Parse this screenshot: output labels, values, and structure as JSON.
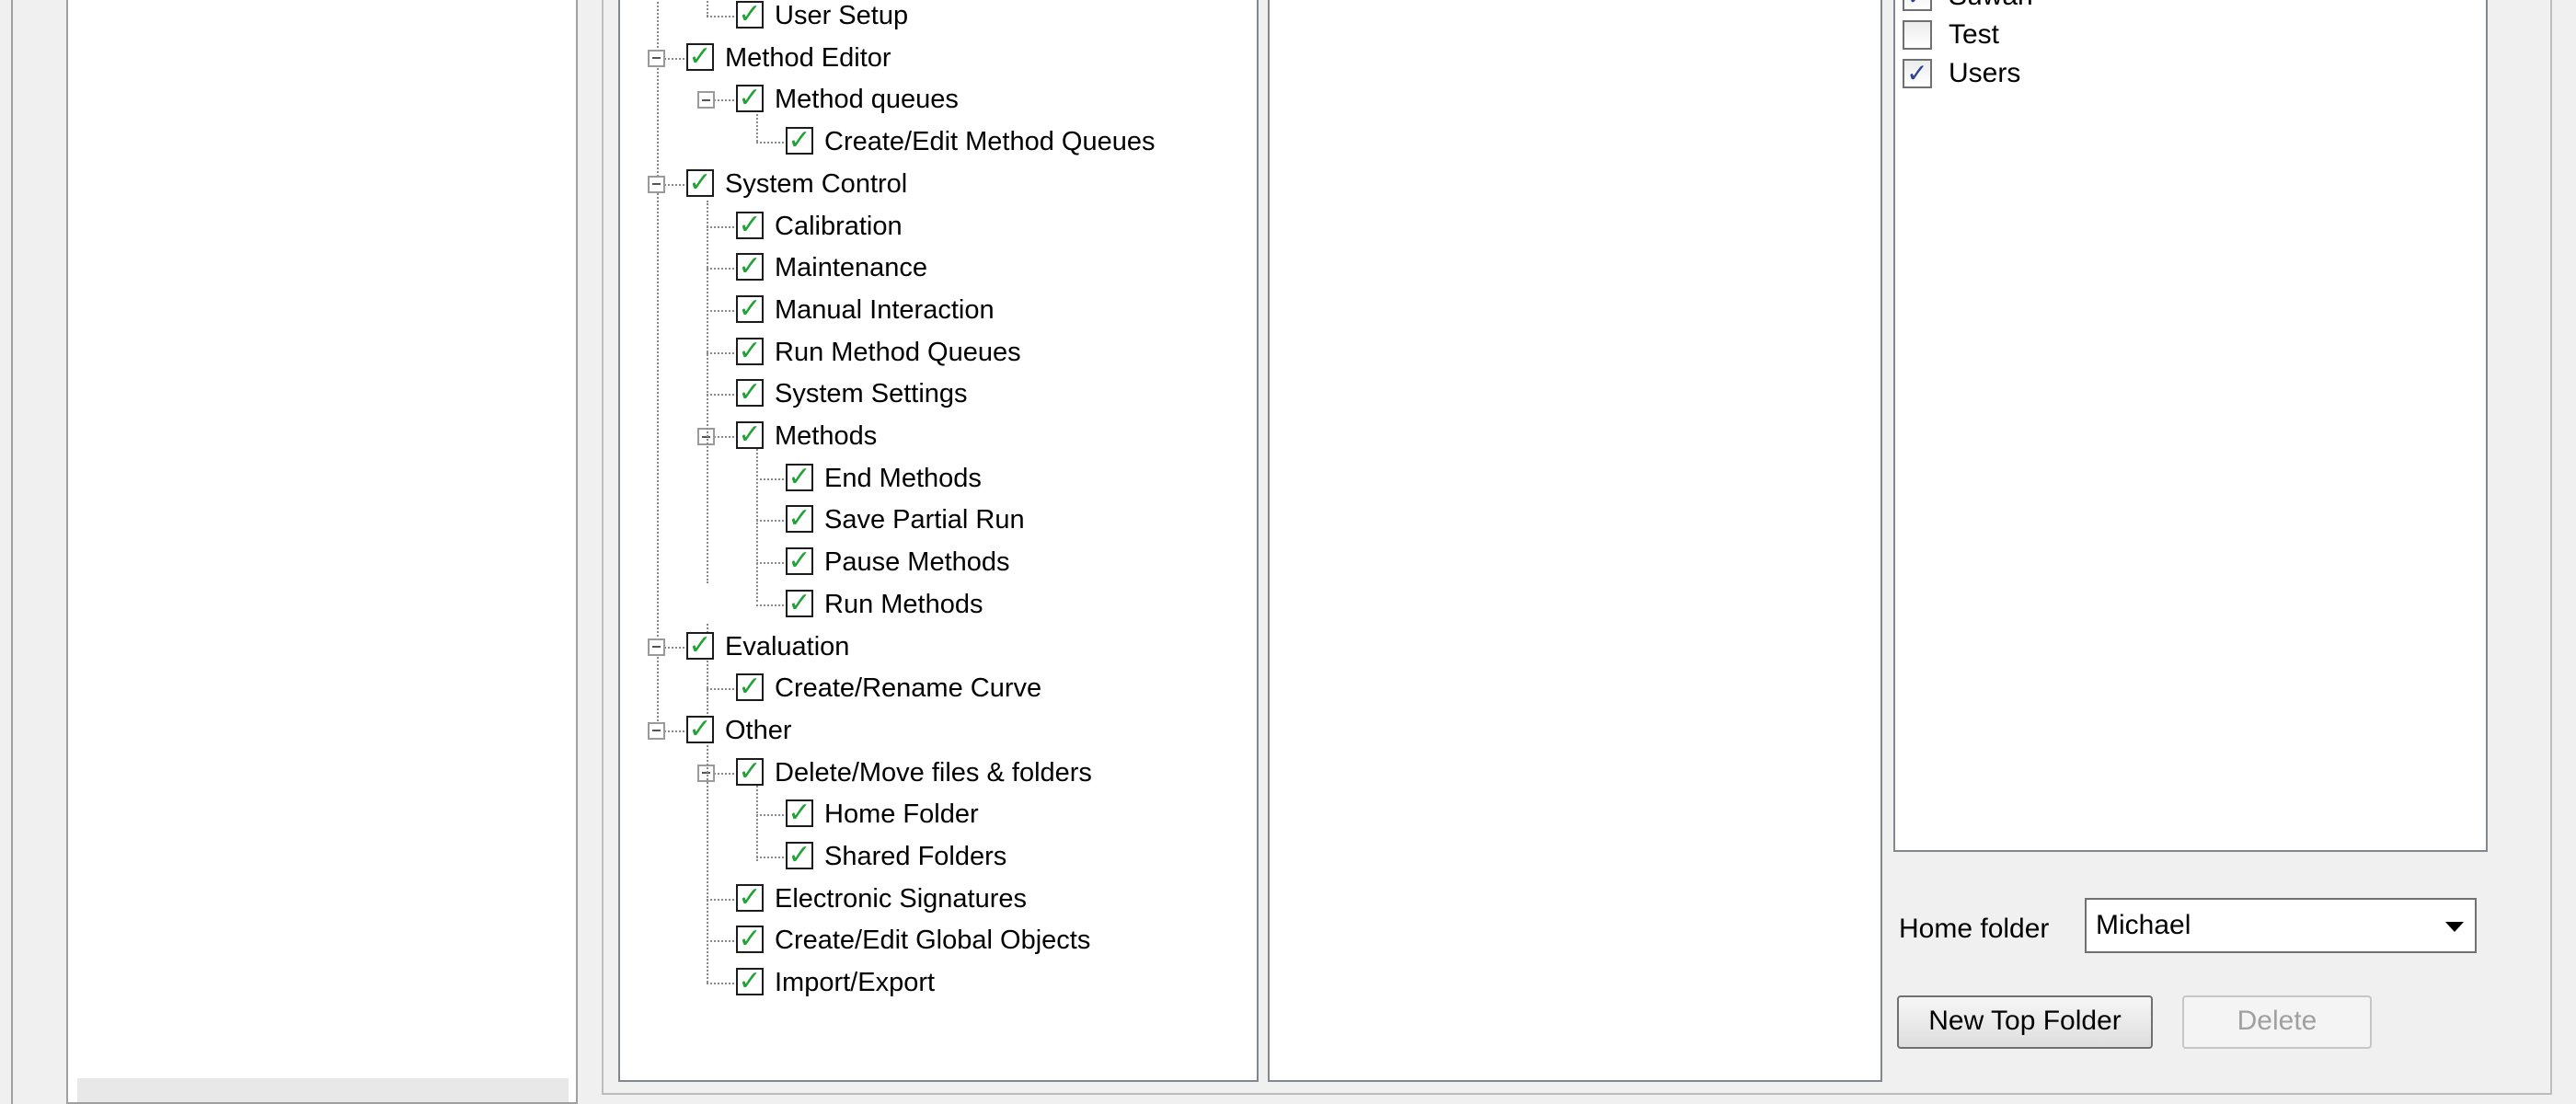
{
  "permissions_tree": {
    "nodes": [
      {
        "id": "user-setup",
        "label": "User Setup",
        "level": 2,
        "expander": false,
        "checked": true
      },
      {
        "id": "method-editor",
        "label": "Method Editor",
        "level": 1,
        "expander": true,
        "checked": true
      },
      {
        "id": "method-queues",
        "label": "Method queues",
        "level": 2,
        "expander": true,
        "checked": true
      },
      {
        "id": "create-edit-method-queues",
        "label": "Create/Edit Method Queues",
        "level": 3,
        "expander": false,
        "checked": true
      },
      {
        "id": "system-control",
        "label": "System Control",
        "level": 1,
        "expander": true,
        "checked": true
      },
      {
        "id": "calibration",
        "label": "Calibration",
        "level": 2,
        "expander": false,
        "checked": true
      },
      {
        "id": "maintenance",
        "label": "Maintenance",
        "level": 2,
        "expander": false,
        "checked": true
      },
      {
        "id": "manual-interaction",
        "label": "Manual Interaction",
        "level": 2,
        "expander": false,
        "checked": true
      },
      {
        "id": "run-method-queues",
        "label": "Run Method Queues",
        "level": 2,
        "expander": false,
        "checked": true
      },
      {
        "id": "system-settings",
        "label": "System Settings",
        "level": 2,
        "expander": false,
        "checked": true
      },
      {
        "id": "methods",
        "label": "Methods",
        "level": 2,
        "expander": true,
        "checked": true
      },
      {
        "id": "end-methods",
        "label": "End Methods",
        "level": 3,
        "expander": false,
        "checked": true
      },
      {
        "id": "save-partial-run",
        "label": "Save Partial Run",
        "level": 3,
        "expander": false,
        "checked": true
      },
      {
        "id": "pause-methods",
        "label": "Pause Methods",
        "level": 3,
        "expander": false,
        "checked": true
      },
      {
        "id": "run-methods",
        "label": "Run Methods",
        "level": 3,
        "expander": false,
        "checked": true
      },
      {
        "id": "evaluation",
        "label": "Evaluation",
        "level": 1,
        "expander": true,
        "checked": true
      },
      {
        "id": "create-rename-curve",
        "label": "Create/Rename Curve",
        "level": 2,
        "expander": false,
        "checked": true
      },
      {
        "id": "other",
        "label": "Other",
        "level": 1,
        "expander": true,
        "checked": true
      },
      {
        "id": "delete-move-files-folders",
        "label": "Delete/Move files & folders",
        "level": 2,
        "expander": true,
        "checked": true
      },
      {
        "id": "home-folder",
        "label": "Home Folder",
        "level": 3,
        "expander": false,
        "checked": true
      },
      {
        "id": "shared-folders",
        "label": "Shared Folders",
        "level": 3,
        "expander": false,
        "checked": true
      },
      {
        "id": "electronic-signatures",
        "label": "Electronic Signatures",
        "level": 2,
        "expander": false,
        "checked": true
      },
      {
        "id": "create-edit-global-objects",
        "label": "Create/Edit Global Objects",
        "level": 2,
        "expander": false,
        "checked": true
      },
      {
        "id": "import-export",
        "label": "Import/Export",
        "level": 2,
        "expander": false,
        "checked": true
      }
    ]
  },
  "folders_list": {
    "items": [
      {
        "label": "Suwan",
        "checked": true
      },
      {
        "label": "Test",
        "checked": false
      },
      {
        "label": "Users",
        "checked": true
      }
    ]
  },
  "home_folder": {
    "label": "Home folder",
    "value": "Michael"
  },
  "buttons": {
    "new_top_folder": "New Top Folder",
    "delete": "Delete"
  },
  "check_glyph": "✓",
  "icons": {
    "tree_check": "check-icon",
    "list_check": "check-icon",
    "expander": "minus-box-icon",
    "dropdown": "chevron-down-icon"
  },
  "colors": {
    "tree_check": "#21a336",
    "list_check": "#2c3f9b",
    "panel_background": "#ffffff",
    "window_background": "#f0f0f0"
  }
}
